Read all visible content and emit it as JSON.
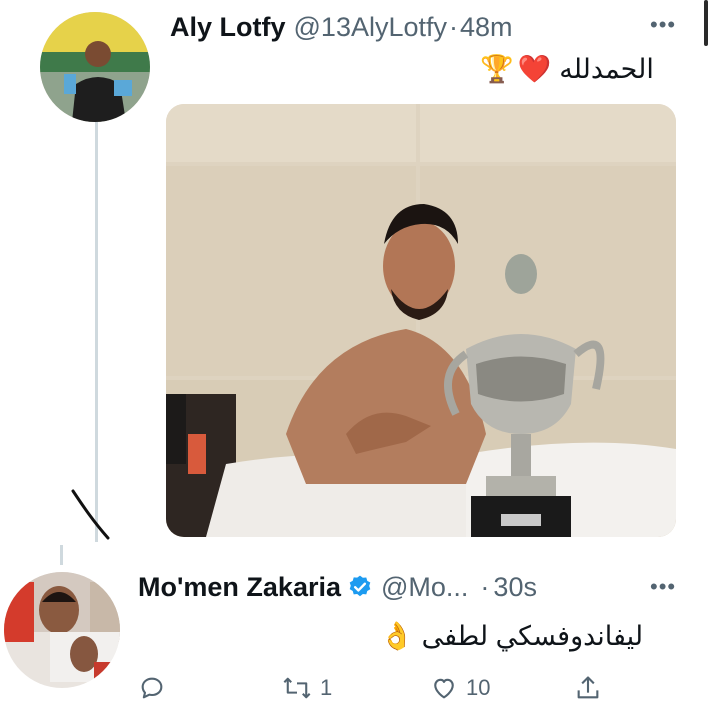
{
  "tweet1": {
    "display_name": "Aly Lotfy",
    "handle": "@13AlyLotfy",
    "sep": "·",
    "time": "48m",
    "text": "الحمدلله",
    "emoji_trophy": "🏆",
    "emoji_heart": "❤️",
    "more": "•••"
  },
  "tweet2": {
    "display_name": "Mo'men Zakaria",
    "handle": "@Mo...",
    "sep": "·",
    "time": "30s",
    "text": "ليفاندوفسكي لطفى",
    "emoji_ok": "👌",
    "more": "•••",
    "actions": {
      "reply_icon": "reply-icon",
      "retweet_icon": "retweet-icon",
      "retweet_count": "1",
      "like_icon": "heart-outline-icon",
      "like_count": "10",
      "share_icon": "share-icon"
    }
  },
  "colors": {
    "text_primary": "#0f1419",
    "text_secondary": "#536471",
    "verified": "#1d9bf0",
    "thread_line": "#cfd9de"
  }
}
